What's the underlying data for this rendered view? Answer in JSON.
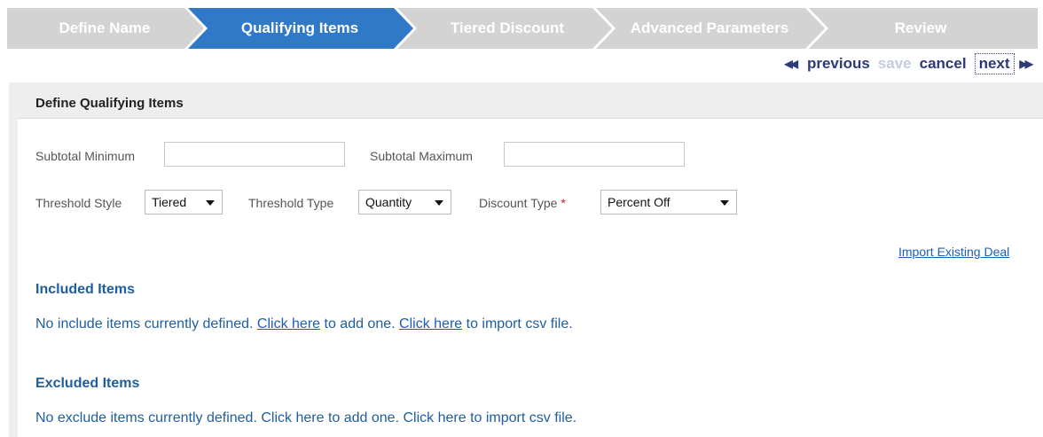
{
  "wizard": {
    "steps": [
      {
        "label": "Define Name",
        "state": "inactive"
      },
      {
        "label": "Qualifying Items",
        "state": "active"
      },
      {
        "label": "Tiered Discount",
        "state": "inactive"
      },
      {
        "label": "Advanced Parameters",
        "state": "inactive"
      },
      {
        "label": "Review",
        "state": "inactive"
      }
    ],
    "colors": {
      "inactive": "#d3d3d3",
      "active": "#2f79c6",
      "separator": "#ffffff"
    }
  },
  "actions": {
    "previous": "previous",
    "save": "save",
    "cancel": "cancel",
    "next": "next",
    "left_arrows": "◀◀",
    "right_arrows": "▶▶"
  },
  "panel": {
    "title": "Define Qualifying Items",
    "subtotal_min_label": "Subtotal Minimum",
    "subtotal_min_value": "",
    "subtotal_max_label": "Subtotal Maximum",
    "subtotal_max_value": "",
    "threshold_style_label": "Threshold Style",
    "threshold_style_value": "Tiered",
    "threshold_type_label": "Threshold Type",
    "threshold_type_value": "Quantity",
    "discount_type_label": "Discount Type",
    "required_mark": "*",
    "discount_type_value": "Percent Off",
    "import_link": "Import Existing Deal"
  },
  "included": {
    "title": "Included Items",
    "text1": "No include items currently defined.",
    "link1": "Click here",
    "text2": "to add one.",
    "link2": "Click here",
    "text3": "to import csv file."
  },
  "excluded": {
    "title": "Excluded Items",
    "text1": "No exclude items currently defined.",
    "link1": "Click here",
    "text2": "to add one.",
    "link2": "Click here",
    "text3": "to import csv file."
  }
}
